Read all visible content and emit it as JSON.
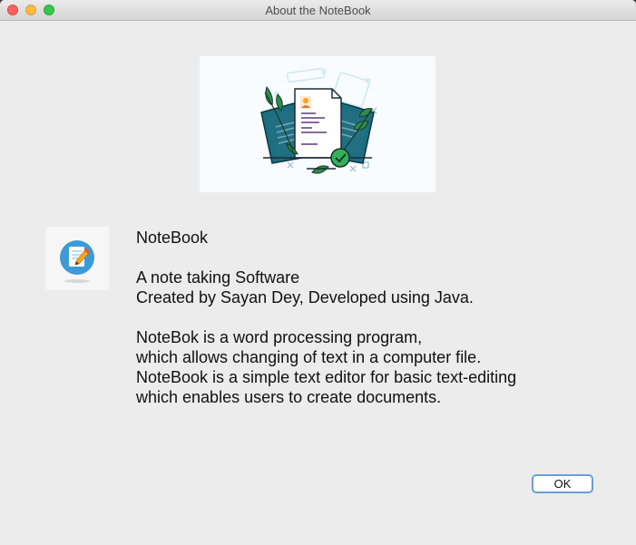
{
  "window": {
    "title": "About the NoteBook"
  },
  "app": {
    "name": "NoteBook"
  },
  "about": {
    "line1": "A note taking Software",
    "line2": "Created by Sayan Dey, Developed using Java.",
    "desc1": "NoteBok is a word processing program,",
    "desc2": "which allows changing of text in a computer file.",
    "desc3": "NoteBook is a simple text editor for basic text-editing",
    "desc4": "which enables users to create documents."
  },
  "buttons": {
    "ok": "OK"
  },
  "icons": {
    "banner": "document-illustration",
    "app": "notebook-pencil-icon"
  }
}
